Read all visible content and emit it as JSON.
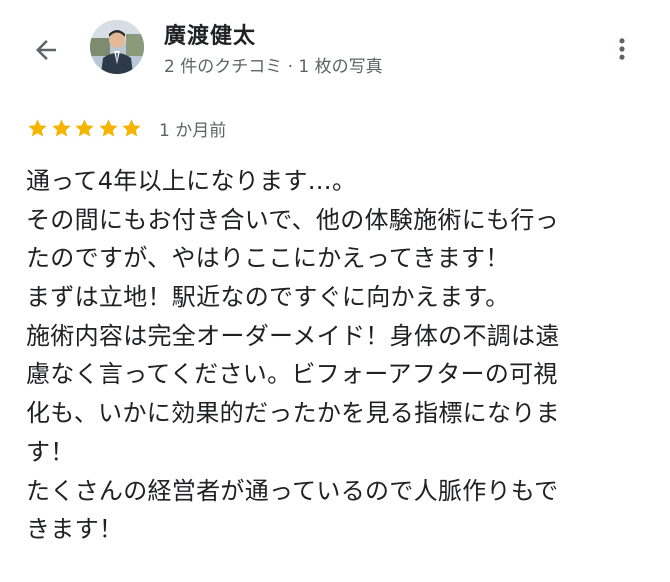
{
  "header": {
    "back_icon": "arrow-back-icon",
    "user_name": "廣渡健太",
    "user_meta": "2 件のクチコミ · 1 枚の写真",
    "more_icon": "more-vert-icon"
  },
  "review": {
    "rating": 5,
    "rating_max": 5,
    "star_color": "#f4b400",
    "time": "1 か月前",
    "lines": [
      "通って4年以上になります…。",
      "その間にもお付き合いで、他の体験施術にも行っ",
      "たのですが、やはりここにかえってきます！",
      "まずは立地！駅近なのですぐに向かえます。",
      "施術内容は完全オーダーメイド！身体の不調は遠",
      "慮なく言ってください。ビフォーアフターの可視",
      "化も、いかに効果的だったかを見る指標になりま",
      "す！",
      "たくさんの経営者が通っているので人脈作りもで",
      "きます！"
    ]
  },
  "colors": {
    "text_primary": "#202124",
    "text_secondary": "#5f6368",
    "icon": "#5f6368"
  }
}
